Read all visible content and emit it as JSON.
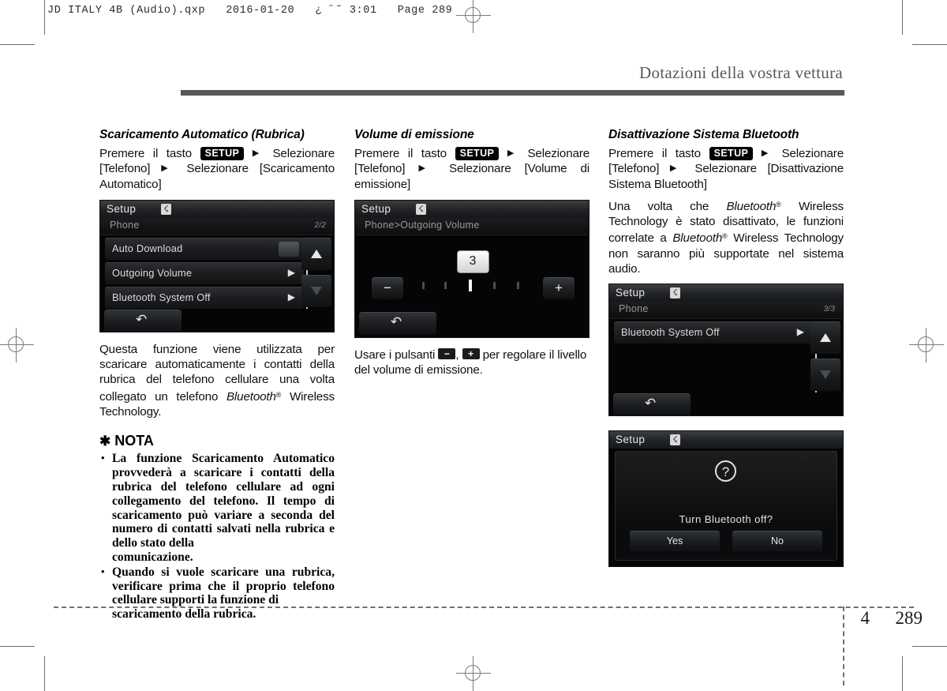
{
  "prepress": {
    "slug": "JD ITALY 4B (Audio).qxp   2016-01-20   ¿ ˝˜ 3:01   Page 289"
  },
  "header": {
    "title": "Dotazioni della vostra vettura"
  },
  "footer": {
    "chapter": "4",
    "page": "289"
  },
  "columns": {
    "left": {
      "heading": "Scaricamento Automatico (Rubrica)",
      "steps_pre": "Premere il tasto",
      "setup_key": "SETUP",
      "steps_post": "Selezionare [Telefono]",
      "steps_post2": "Selezionare [Scaricamento Automatico]",
      "paragraph": "Questa funzione viene utilizzata per scaricare automaticamente i contatti della rubrica del telefono cellulare una volta collegato un telefono",
      "paragraph_bt": "Bluetooth",
      "paragraph_tail": "Wireless Technology.",
      "nota_label": "NOTA",
      "nota_items": [
        "La funzione Scaricamento Automatico provvederà a scaricare i contatti della rubrica del telefono cellulare ad ogni collegamento del telefono. Il tempo di scaricamento può variare a seconda del numero di contatti salvati nella rubrica e dello stato della",
        "Quando si vuole scaricare una rubrica, verificare prima che il proprio telefono cellulare supporti la funzione di"
      ],
      "nota_tails": [
        "comunicazione.",
        "scaricamento della rubrica."
      ],
      "screen": {
        "title": "Setup",
        "bt_icon": "bluetooth-icon",
        "breadcrumb": "Phone",
        "page_indicator": "2/2",
        "items": [
          {
            "label": "Auto Download",
            "control": "toggle"
          },
          {
            "label": "Outgoing Volume",
            "control": "chevron"
          },
          {
            "label": "Bluetooth System Off",
            "control": "chevron"
          }
        ],
        "back_icon": "back-arrow-icon",
        "scroll_up": "scroll-up-icon",
        "scroll_down": "scroll-down-icon"
      }
    },
    "middle": {
      "heading": "Volume di emissione",
      "steps_pre": "Premere il tasto",
      "setup_key": "SETUP",
      "steps_post": "Selezionare [Telefono]",
      "steps_post2": "Selezionare [Volume di emissione]",
      "caption_pre": "Usare i pulsanti",
      "key_minus": "−",
      "key_plus": "+",
      "caption_mid": ",",
      "caption_post": "per regolare il livello del volume di emissione.",
      "screen": {
        "title": "Setup",
        "bt_icon": "bluetooth-icon",
        "breadcrumb": "Phone>Outgoing Volume",
        "value": "3",
        "minus_label": "−",
        "plus_label": "+",
        "ticks_total": 5,
        "tick_active_index": 2,
        "back_icon": "back-arrow-icon"
      }
    },
    "right": {
      "heading": "Disattivazione Sistema Bluetooth",
      "steps_pre": "Premere il tasto",
      "setup_key": "SETUP",
      "steps_post": "Selezionare [Telefono]",
      "steps_post2": "Selezionare [Disattivazione Sistema Bluetooth]",
      "paragraph_a": "Una volta che",
      "paragraph_bt1": "Bluetooth",
      "paragraph_b": "Wireless Technology è stato disattivato, le funzioni correlate a",
      "paragraph_bt2": "Bluetooth",
      "paragraph_c": "Wireless Technology non saranno più supportate nel sistema audio.",
      "screen_list": {
        "title": "Setup",
        "bt_icon": "bluetooth-icon",
        "breadcrumb": "Phone",
        "page_indicator": "3/3",
        "items": [
          {
            "label": "Bluetooth System Off",
            "control": "chevron"
          }
        ],
        "back_icon": "back-arrow-icon",
        "scroll_up": "scroll-up-icon",
        "scroll_down": "scroll-down-icon"
      },
      "screen_dialog": {
        "title": "Setup",
        "bt_icon": "bluetooth-icon",
        "question_icon": "?",
        "message": "Turn Bluetooth off?",
        "yes_label": "Yes",
        "no_label": "No"
      }
    }
  }
}
